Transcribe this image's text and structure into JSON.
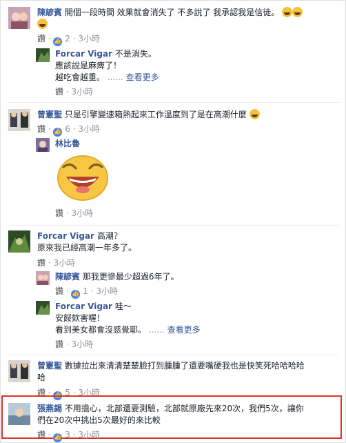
{
  "actions": {
    "like": "讚",
    "more": "查看更多"
  },
  "colors": {
    "link": "#365899",
    "meta": "#90949c",
    "highlight": "#d9342b",
    "like_badge": "#4080ff"
  },
  "comments": [
    {
      "name": "陳諺賓",
      "text": "開個一段時間 效果就會消失了 不多說了 我承認我是信徒。",
      "likes": "2",
      "time": "3小時"
    },
    {
      "name": "Forcar Vigar",
      "line1": "不是消失。",
      "line2": "應該說是麻痺了！",
      "line3": "越吃會越重。",
      "ellipsis": "......",
      "time": "3小時"
    },
    {
      "name": "曾憲聖",
      "text": "只是引擎變速箱熱起來工作溫度到了是在高潮什麼",
      "likes": "6",
      "time": "3小時"
    },
    {
      "name": "林比魯",
      "time": "3小時"
    },
    {
      "name": "Forcar Vigar",
      "line1": "高潮？",
      "line2": "原來我已經高潮一年多了。",
      "time": "3小時"
    },
    {
      "name": "陳諺賓",
      "text": "那我更慘最少超過6年了。",
      "likes": "1",
      "time": "3小時"
    },
    {
      "name": "Forcar Vigar",
      "line1": "哇～",
      "line2": "安餒欸害喔！",
      "line3": "看到美女都會沒感覺耶。",
      "ellipsis": "......",
      "time": "3小時"
    },
    {
      "name": "曾憲聖",
      "line1": "數據拉出來清清楚楚臉打到腫腫了還要嘴硬我也是快笑死哈哈哈哈",
      "line2": "哈",
      "likes": "5",
      "time": "3小時"
    },
    {
      "name": "張燕錫",
      "line1": "不用擔心，北部還要測驗，北部就原廠先來20次，我們5次，讓你",
      "line2": "們在20次中挑出5次最好的來比較",
      "likes": "3",
      "time": "3小時"
    }
  ]
}
